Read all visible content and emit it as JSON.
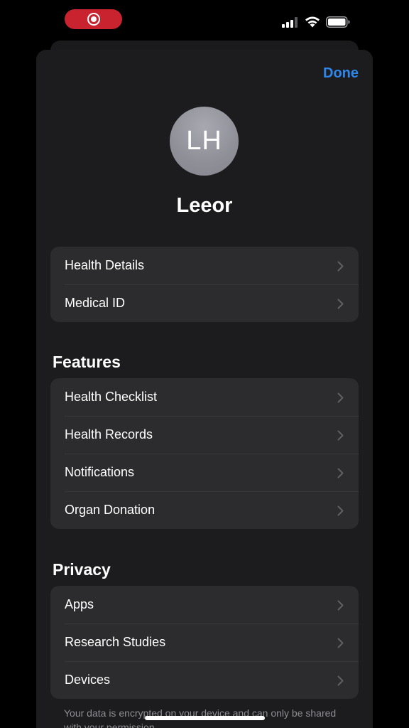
{
  "status_bar": {
    "recording": true,
    "signal_bars": 3,
    "accent": "#c8232f"
  },
  "header": {
    "done_label": "Done",
    "done_color": "#2f86ea"
  },
  "profile": {
    "initials": "LH",
    "name": "Leeor"
  },
  "account": {
    "items": [
      {
        "label": "Health Details",
        "icon": "chevron-right-icon"
      },
      {
        "label": "Medical ID",
        "icon": "chevron-right-icon"
      }
    ]
  },
  "features": {
    "title": "Features",
    "items": [
      {
        "label": "Health Checklist",
        "icon": "chevron-right-icon"
      },
      {
        "label": "Health Records",
        "icon": "chevron-right-icon"
      },
      {
        "label": "Notifications",
        "icon": "chevron-right-icon"
      },
      {
        "label": "Organ Donation",
        "icon": "chevron-right-icon"
      }
    ]
  },
  "privacy": {
    "title": "Privacy",
    "items": [
      {
        "label": "Apps",
        "icon": "chevron-right-icon"
      },
      {
        "label": "Research Studies",
        "icon": "chevron-right-icon"
      },
      {
        "label": "Devices",
        "icon": "chevron-right-icon"
      }
    ],
    "footer": "Your data is encrypted on your device and can only be shared with your permission."
  }
}
